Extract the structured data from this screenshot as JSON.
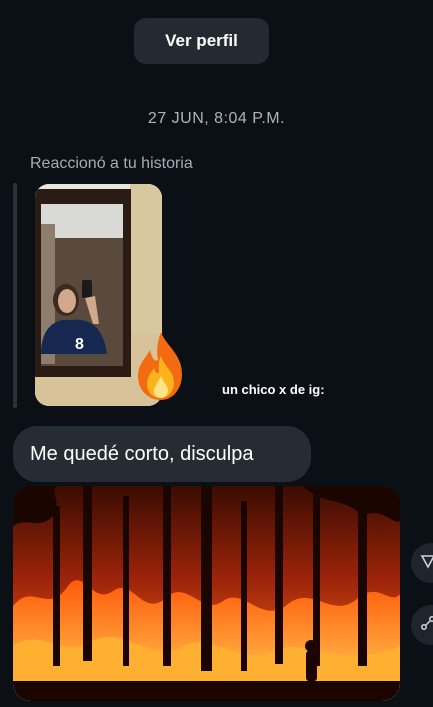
{
  "header": {
    "view_profile_label": "Ver perfil"
  },
  "thread": {
    "timestamp": "27 JUN, 8:04 P.M.",
    "story_reply_label": "Reaccionó a tu historia",
    "story_overlay_text": "un chico x de ig:",
    "story_reaction_emoji": "fire",
    "message_text": "Me quedé corto, disculpa",
    "jersey_number": "8"
  },
  "colors": {
    "background": "#0b1016",
    "bubble": "#262c33",
    "button": "#232a32",
    "muted_text": "#a6acb3"
  },
  "icons": [
    "fire-icon",
    "reply-icon",
    "share-icon"
  ]
}
